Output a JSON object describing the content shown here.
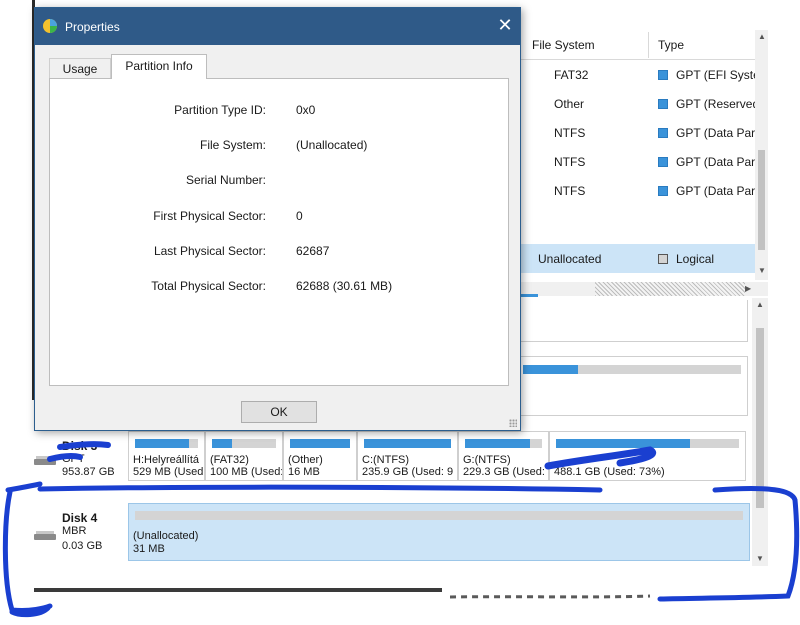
{
  "dialog": {
    "title": "Properties",
    "close_glyph": "✕",
    "tabs": [
      {
        "label": "Usage",
        "active": false
      },
      {
        "label": "Partition Info",
        "active": true
      }
    ],
    "fields": [
      {
        "label": "Partition Type ID:",
        "value": "0x0"
      },
      {
        "label": "File System:",
        "value": "(Unallocated)"
      },
      {
        "label": "Serial Number:",
        "value": ""
      },
      {
        "label": "First Physical Sector:",
        "value": "0"
      },
      {
        "label": "Last Physical Sector:",
        "value": "62687"
      },
      {
        "label": "Total Physical Sector:",
        "value": "62688 (30.61 MB)"
      }
    ],
    "ok_label": "OK"
  },
  "partition_table": {
    "headers": [
      "File System",
      "Type"
    ],
    "rows": [
      {
        "fs": "FAT32",
        "type": "GPT (EFI System",
        "selected": false
      },
      {
        "fs": "Other",
        "type": "GPT (Reserved",
        "selected": false
      },
      {
        "fs": "NTFS",
        "type": "GPT (Data Parti",
        "selected": false
      },
      {
        "fs": "NTFS",
        "type": "GPT (Data Parti",
        "selected": false
      },
      {
        "fs": "NTFS",
        "type": "GPT (Data Parti",
        "selected": false
      },
      {
        "fs": "Unallocated",
        "type": "Logical",
        "selected": true
      }
    ]
  },
  "disk3": {
    "name": "Disk 3",
    "style": "GPT",
    "size": "953.87 GB",
    "partitions": [
      {
        "line1": "H:Helyreállítá",
        "line2": "529 MB (Used:",
        "used_fraction": 0.85
      },
      {
        "line1": "(FAT32)",
        "line2": "100 MB (Used:",
        "used_fraction": 0.32
      },
      {
        "line1": "(Other)",
        "line2": "16 MB",
        "used_fraction": 1.0
      },
      {
        "line1": "C:(NTFS)",
        "line2": "235.9 GB (Used: 9",
        "used_fraction": 1.0
      },
      {
        "line1": "G:(NTFS)",
        "line2": "229.3 GB (Used:",
        "used_fraction": 0.85
      },
      {
        "line1": "",
        "line2": "488.1 GB (Used: 73%)",
        "used_fraction": 0.73
      }
    ]
  },
  "disk4": {
    "name": "Disk 4",
    "style": "MBR",
    "size": "0.03 GB",
    "partition": {
      "line1": "(Unallocated)",
      "line2": "31 MB",
      "used_fraction": 0
    }
  },
  "colors": {
    "accent": "#3a93da",
    "titlebar": "#2f5a88",
    "selection": "#cce4f7",
    "scribble": "#1a3fd0"
  }
}
